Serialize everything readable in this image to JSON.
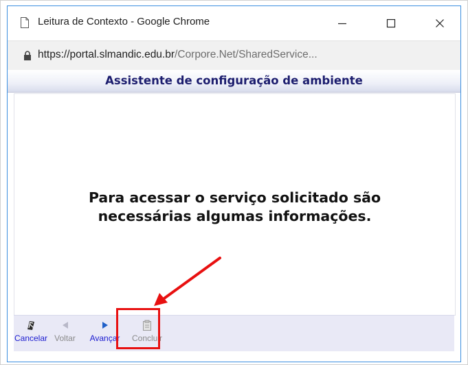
{
  "window": {
    "title": "Leitura de Contexto - Google Chrome"
  },
  "address": {
    "host": "https://portal.slmandic.edu.br",
    "path": "/Corpore.Net/SharedService..."
  },
  "wizard": {
    "title": "Assistente de configuração de ambiente",
    "message_line1": "Para acessar o serviço solicitado são",
    "message_line2": "necessárias algumas informações."
  },
  "toolbar": {
    "cancel_label": "Cancelar",
    "back_label": "Voltar",
    "next_label": "Avançar",
    "finish_label": "Concluir"
  },
  "colors": {
    "accent": "#1a1ad0",
    "disabled": "#8a8a8a",
    "annotation": "#e81010",
    "header_text": "#1c1d6e",
    "toolbar_bg": "#e9e9f6"
  },
  "icons": {
    "page": "page-icon",
    "lock": "lock-icon",
    "minimize": "minimize-icon",
    "maximize": "maximize-icon",
    "close": "close-icon",
    "cancel": "cancel-icon",
    "back": "left-triangle-icon",
    "next": "right-triangle-icon",
    "finish": "clipboard-icon"
  }
}
